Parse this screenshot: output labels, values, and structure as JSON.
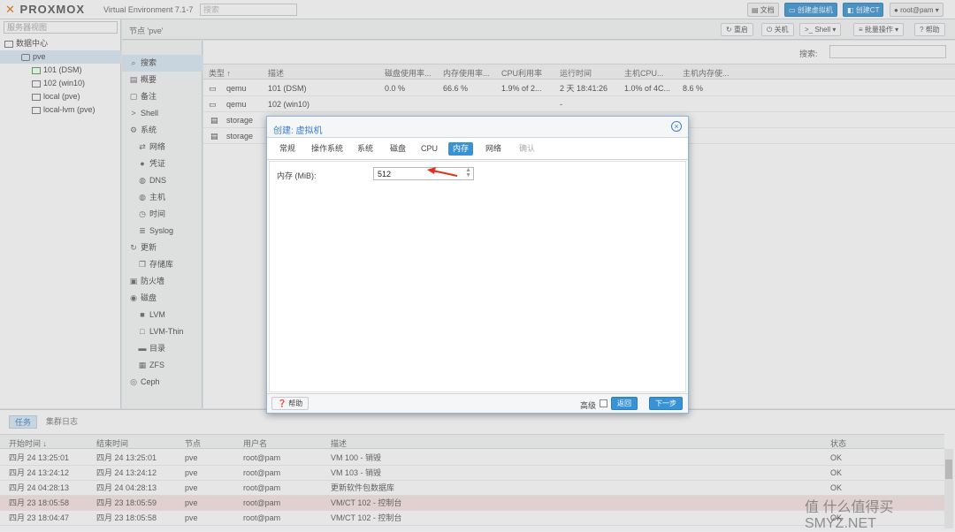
{
  "header": {
    "logo": "PROXMOX",
    "version": "Virtual Environment 7.1-7",
    "search_placeholder": "搜索",
    "docs": "文档",
    "create_vm": "创建虚拟机",
    "create_ct": "创建CT",
    "user": "root@pam"
  },
  "tree": {
    "view_selector": "服务器视图",
    "items": [
      {
        "label": "数据中心"
      },
      {
        "label": "pve"
      },
      {
        "label": "101 (DSM)"
      },
      {
        "label": "102 (win10)"
      },
      {
        "label": "local (pve)"
      },
      {
        "label": "local-lvm (pve)"
      }
    ]
  },
  "node": {
    "title": "节点 'pve'",
    "buttons": {
      "reboot": "重启",
      "shutdown": "关机",
      "shell": "Shell",
      "bulk": "批量操作",
      "help": "帮助"
    }
  },
  "menu": [
    {
      "label": "搜索"
    },
    {
      "label": "概要"
    },
    {
      "label": "备注"
    },
    {
      "label": "Shell"
    },
    {
      "label": "系统"
    },
    {
      "label": "网络"
    },
    {
      "label": "凭证"
    },
    {
      "label": "DNS"
    },
    {
      "label": "主机"
    },
    {
      "label": "时间"
    },
    {
      "label": "Syslog"
    },
    {
      "label": "更新"
    },
    {
      "label": "存储库"
    },
    {
      "label": "防火墙"
    },
    {
      "label": "磁盘"
    },
    {
      "label": "LVM"
    },
    {
      "label": "LVM-Thin"
    },
    {
      "label": "目录"
    },
    {
      "label": "ZFS"
    },
    {
      "label": "Ceph"
    }
  ],
  "grid": {
    "search_label": "搜索:",
    "columns": [
      "类型 ↑",
      "描述",
      "磁盘使用率...",
      "内存使用率...",
      "CPU利用率",
      "运行时间",
      "主机CPU...",
      "主机内存使..."
    ],
    "rows": [
      {
        "type": "qemu",
        "desc": "101 (DSM)",
        "disk": "0.0 %",
        "mem": "66.6 %",
        "cpu": "1.9% of 2...",
        "uptime": "2 天 18:41:26",
        "hostcpu": "1.0% of 4C...",
        "hostmem": "8.6 %"
      },
      {
        "type": "qemu",
        "desc": "102 (win10)",
        "disk": "",
        "mem": "",
        "cpu": "",
        "uptime": "-",
        "hostcpu": "",
        "hostmem": ""
      },
      {
        "type": "storage",
        "desc": "",
        "disk": "",
        "mem": "",
        "cpu": "",
        "uptime": "",
        "hostcpu": "",
        "hostmem": ""
      },
      {
        "type": "storage",
        "desc": "",
        "disk": "",
        "mem": "",
        "cpu": "",
        "uptime": "",
        "hostcpu": "",
        "hostmem": ""
      }
    ]
  },
  "dialog": {
    "title": "创建: 虚拟机",
    "tabs": [
      "常规",
      "操作系统",
      "系统",
      "磁盘",
      "CPU",
      "内存",
      "网络",
      "确认"
    ],
    "active_tab": "内存",
    "memory_label": "内存 (MiB):",
    "memory_value": "512",
    "help": "帮助",
    "advanced": "高级",
    "back": "返回",
    "next": "下一步"
  },
  "tasks": {
    "tabs": [
      "任务",
      "集群日志"
    ],
    "columns": [
      "开始时间 ↓",
      "结束时间",
      "节点",
      "用户名",
      "描述",
      "状态"
    ],
    "rows": [
      {
        "start": "四月 24 13:25:01",
        "end": "四月 24 13:25:01",
        "node": "pve",
        "user": "root@pam",
        "desc": "VM 100 - 销毁",
        "status": "OK"
      },
      {
        "start": "四月 24 13:24:12",
        "end": "四月 24 13:24:12",
        "node": "pve",
        "user": "root@pam",
        "desc": "VM 103 - 销毁",
        "status": "OK"
      },
      {
        "start": "四月 24 04:28:13",
        "end": "四月 24 04:28:13",
        "node": "pve",
        "user": "root@pam",
        "desc": "更新软件包数据库",
        "status": "OK"
      },
      {
        "start": "四月 23 18:05:58",
        "end": "四月 23 18:05:59",
        "node": "pve",
        "user": "root@pam",
        "desc": "VM/CT 102 - 控制台",
        "status": ""
      },
      {
        "start": "四月 23 18:04:47",
        "end": "四月 23 18:05:58",
        "node": "pve",
        "user": "root@pam",
        "desc": "VM/CT 102 - 控制台",
        "status": "OK"
      }
    ]
  },
  "watermark": "值 什么值得买 SMYZ.NET",
  "colors": {
    "accent": "#3892d4",
    "logo_x": "#e57000",
    "selection": "#d9e8f5",
    "arrow": "#e0301e"
  }
}
